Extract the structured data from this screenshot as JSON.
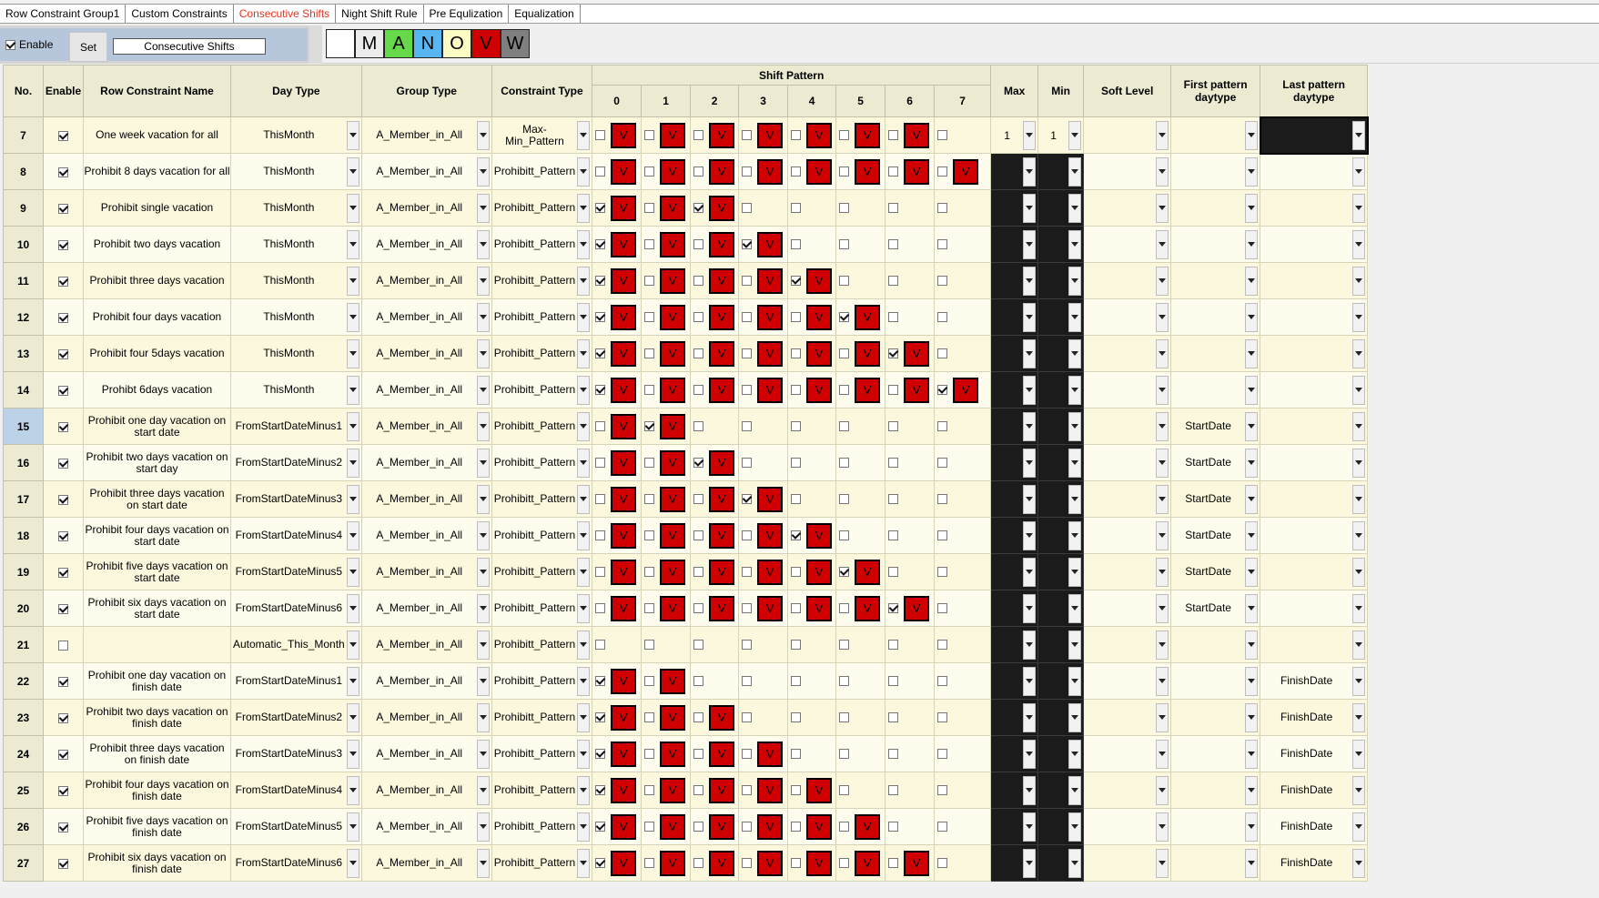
{
  "tabs": [
    "Row Constraint Group1",
    "Custom Constraints",
    "Consecutive Shifts",
    "Night Shift Rule",
    "Pre Equlization",
    "Equalization"
  ],
  "active_tab": 2,
  "toolbar": {
    "enable_label": "Enable",
    "set_label": "Set",
    "name_value": "Consecutive Shifts",
    "shift_buttons": [
      {
        "label": "",
        "color": "#ffffff"
      },
      {
        "label": "M",
        "color": "#ececec"
      },
      {
        "label": "A",
        "color": "#66d94a"
      },
      {
        "label": "N",
        "color": "#58b7f2"
      },
      {
        "label": "O",
        "color": "#fdfcc4"
      },
      {
        "label": "V",
        "color": "#d10000"
      },
      {
        "label": "W",
        "color": "#7f7f7f"
      }
    ]
  },
  "headers": {
    "no": "No.",
    "enable": "Enable",
    "name": "Row Constraint Name",
    "day_type": "Day Type",
    "group_type": "Group Type",
    "constraint_type": "Constraint Type",
    "shift_pattern": "Shift Pattern",
    "pattern_cols": [
      "0",
      "1",
      "2",
      "3",
      "4",
      "5",
      "6",
      "7"
    ],
    "max": "Max",
    "min": "Min",
    "soft_level": "Soft Level",
    "first_pattern": "First pattern daytype",
    "last_pattern": "Last pattern daytype"
  },
  "rows": [
    {
      "no": "7",
      "enable": true,
      "name": "One week vacation for all",
      "day_type": "ThisMonth",
      "group": "A_Member_in_All",
      "ctype": "Max-Min_Pattern",
      "pattern": [
        [
          false,
          true
        ],
        [
          false,
          true
        ],
        [
          false,
          true
        ],
        [
          false,
          true
        ],
        [
          false,
          true
        ],
        [
          false,
          true
        ],
        [
          false,
          true
        ],
        [
          false,
          false
        ]
      ],
      "max": "1",
      "min": "1",
      "first": "",
      "last": "",
      "selected": false
    },
    {
      "no": "8",
      "enable": true,
      "name": "Prohibit 8 days vacation for all",
      "day_type": "ThisMonth",
      "group": "A_Member_in_All",
      "ctype": "Prohibitt_Pattern",
      "pattern": [
        [
          false,
          true
        ],
        [
          false,
          true
        ],
        [
          false,
          true
        ],
        [
          false,
          true
        ],
        [
          false,
          true
        ],
        [
          false,
          true
        ],
        [
          false,
          true
        ],
        [
          false,
          true
        ]
      ],
      "max": "",
      "min": "",
      "first": "",
      "last": "",
      "selected": false
    },
    {
      "no": "9",
      "enable": true,
      "name": "Prohibit single vacation",
      "day_type": "ThisMonth",
      "group": "A_Member_in_All",
      "ctype": "Prohibitt_Pattern",
      "pattern": [
        [
          true,
          true
        ],
        [
          false,
          true
        ],
        [
          true,
          true
        ],
        [
          false,
          false
        ],
        [
          false,
          false
        ],
        [
          false,
          false
        ],
        [
          false,
          false
        ],
        [
          false,
          false
        ]
      ],
      "max": "",
      "min": "",
      "first": "",
      "last": "",
      "selected": false
    },
    {
      "no": "10",
      "enable": true,
      "name": "Prohibit two days vacation",
      "day_type": "ThisMonth",
      "group": "A_Member_in_All",
      "ctype": "Prohibitt_Pattern",
      "pattern": [
        [
          true,
          true
        ],
        [
          false,
          true
        ],
        [
          false,
          true
        ],
        [
          true,
          true
        ],
        [
          false,
          false
        ],
        [
          false,
          false
        ],
        [
          false,
          false
        ],
        [
          false,
          false
        ]
      ],
      "max": "",
      "min": "",
      "first": "",
      "last": "",
      "selected": false
    },
    {
      "no": "11",
      "enable": true,
      "name": "Prohibit three days vacation",
      "day_type": "ThisMonth",
      "group": "A_Member_in_All",
      "ctype": "Prohibitt_Pattern",
      "pattern": [
        [
          true,
          true
        ],
        [
          false,
          true
        ],
        [
          false,
          true
        ],
        [
          false,
          true
        ],
        [
          true,
          true
        ],
        [
          false,
          false
        ],
        [
          false,
          false
        ],
        [
          false,
          false
        ]
      ],
      "max": "",
      "min": "",
      "first": "",
      "last": "",
      "selected": false
    },
    {
      "no": "12",
      "enable": true,
      "name": "Prohibit four days vacation",
      "day_type": "ThisMonth",
      "group": "A_Member_in_All",
      "ctype": "Prohibitt_Pattern",
      "pattern": [
        [
          true,
          true
        ],
        [
          false,
          true
        ],
        [
          false,
          true
        ],
        [
          false,
          true
        ],
        [
          false,
          true
        ],
        [
          true,
          true
        ],
        [
          false,
          false
        ],
        [
          false,
          false
        ]
      ],
      "max": "",
      "min": "",
      "first": "",
      "last": "",
      "selected": false
    },
    {
      "no": "13",
      "enable": true,
      "name": "Prohibit four 5days vacation",
      "day_type": "ThisMonth",
      "group": "A_Member_in_All",
      "ctype": "Prohibitt_Pattern",
      "pattern": [
        [
          true,
          true
        ],
        [
          false,
          true
        ],
        [
          false,
          true
        ],
        [
          false,
          true
        ],
        [
          false,
          true
        ],
        [
          false,
          true
        ],
        [
          true,
          true
        ],
        [
          false,
          false
        ]
      ],
      "max": "",
      "min": "",
      "first": "",
      "last": "",
      "selected": false
    },
    {
      "no": "14",
      "enable": true,
      "name": "Prohibt 6days vacation",
      "day_type": "ThisMonth",
      "group": "A_Member_in_All",
      "ctype": "Prohibitt_Pattern",
      "pattern": [
        [
          true,
          true
        ],
        [
          false,
          true
        ],
        [
          false,
          true
        ],
        [
          false,
          true
        ],
        [
          false,
          true
        ],
        [
          false,
          true
        ],
        [
          false,
          true
        ],
        [
          true,
          true
        ]
      ],
      "max": "",
      "min": "",
      "first": "",
      "last": "",
      "selected": false
    },
    {
      "no": "15",
      "enable": true,
      "name": "Prohibit one day vacation on start date",
      "day_type": "FromStartDateMinus1",
      "group": "A_Member_in_All",
      "ctype": "Prohibitt_Pattern",
      "pattern": [
        [
          false,
          true
        ],
        [
          true,
          true
        ],
        [
          false,
          false
        ],
        [
          false,
          false
        ],
        [
          false,
          false
        ],
        [
          false,
          false
        ],
        [
          false,
          false
        ],
        [
          false,
          false
        ]
      ],
      "max": "",
      "min": "",
      "first": "StartDate",
      "last": "",
      "selected": true
    },
    {
      "no": "16",
      "enable": true,
      "name": "Prohibit two days vacation on start day",
      "day_type": "FromStartDateMinus2",
      "group": "A_Member_in_All",
      "ctype": "Prohibitt_Pattern",
      "pattern": [
        [
          false,
          true
        ],
        [
          false,
          true
        ],
        [
          true,
          true
        ],
        [
          false,
          false
        ],
        [
          false,
          false
        ],
        [
          false,
          false
        ],
        [
          false,
          false
        ],
        [
          false,
          false
        ]
      ],
      "max": "",
      "min": "",
      "first": "StartDate",
      "last": "",
      "selected": false
    },
    {
      "no": "17",
      "enable": true,
      "name": "Prohibit three days vacation on start date",
      "day_type": "FromStartDateMinus3",
      "group": "A_Member_in_All",
      "ctype": "Prohibitt_Pattern",
      "pattern": [
        [
          false,
          true
        ],
        [
          false,
          true
        ],
        [
          false,
          true
        ],
        [
          true,
          true
        ],
        [
          false,
          false
        ],
        [
          false,
          false
        ],
        [
          false,
          false
        ],
        [
          false,
          false
        ]
      ],
      "max": "",
      "min": "",
      "first": "StartDate",
      "last": "",
      "selected": false
    },
    {
      "no": "18",
      "enable": true,
      "name": "Prohibit four days vacation on start date",
      "day_type": "FromStartDateMinus4",
      "group": "A_Member_in_All",
      "ctype": "Prohibitt_Pattern",
      "pattern": [
        [
          false,
          true
        ],
        [
          false,
          true
        ],
        [
          false,
          true
        ],
        [
          false,
          true
        ],
        [
          true,
          true
        ],
        [
          false,
          false
        ],
        [
          false,
          false
        ],
        [
          false,
          false
        ]
      ],
      "max": "",
      "min": "",
      "first": "StartDate",
      "last": "",
      "selected": false
    },
    {
      "no": "19",
      "enable": true,
      "name": "Prohibit five days vacation on start date",
      "day_type": "FromStartDateMinus5",
      "group": "A_Member_in_All",
      "ctype": "Prohibitt_Pattern",
      "pattern": [
        [
          false,
          true
        ],
        [
          false,
          true
        ],
        [
          false,
          true
        ],
        [
          false,
          true
        ],
        [
          false,
          true
        ],
        [
          true,
          true
        ],
        [
          false,
          false
        ],
        [
          false,
          false
        ]
      ],
      "max": "",
      "min": "",
      "first": "StartDate",
      "last": "",
      "selected": false
    },
    {
      "no": "20",
      "enable": true,
      "name": "Prohibit six days vacation on start date",
      "day_type": "FromStartDateMinus6",
      "group": "A_Member_in_All",
      "ctype": "Prohibitt_Pattern",
      "pattern": [
        [
          false,
          true
        ],
        [
          false,
          true
        ],
        [
          false,
          true
        ],
        [
          false,
          true
        ],
        [
          false,
          true
        ],
        [
          false,
          true
        ],
        [
          true,
          true
        ],
        [
          false,
          false
        ]
      ],
      "max": "",
      "min": "",
      "first": "StartDate",
      "last": "",
      "selected": false
    },
    {
      "no": "21",
      "enable": false,
      "name": "",
      "day_type": "Automatic_This_Month",
      "group": "A_Member_in_All",
      "ctype": "Prohibitt_Pattern",
      "pattern": [
        [
          false,
          false
        ],
        [
          false,
          false
        ],
        [
          false,
          false
        ],
        [
          false,
          false
        ],
        [
          false,
          false
        ],
        [
          false,
          false
        ],
        [
          false,
          false
        ],
        [
          false,
          false
        ]
      ],
      "max": "",
      "min": "",
      "first": "",
      "last": "",
      "selected": false
    },
    {
      "no": "22",
      "enable": true,
      "name": "Prohibit one day vacation on finish date",
      "day_type": "FromStartDateMinus1",
      "group": "A_Member_in_All",
      "ctype": "Prohibitt_Pattern",
      "pattern": [
        [
          true,
          true
        ],
        [
          false,
          true
        ],
        [
          false,
          false
        ],
        [
          false,
          false
        ],
        [
          false,
          false
        ],
        [
          false,
          false
        ],
        [
          false,
          false
        ],
        [
          false,
          false
        ]
      ],
      "max": "",
      "min": "",
      "first": "",
      "last": "FinishDate",
      "selected": false
    },
    {
      "no": "23",
      "enable": true,
      "name": "Prohibit two days vacation on finish date",
      "day_type": "FromStartDateMinus2",
      "group": "A_Member_in_All",
      "ctype": "Prohibitt_Pattern",
      "pattern": [
        [
          true,
          true
        ],
        [
          false,
          true
        ],
        [
          false,
          true
        ],
        [
          false,
          false
        ],
        [
          false,
          false
        ],
        [
          false,
          false
        ],
        [
          false,
          false
        ],
        [
          false,
          false
        ]
      ],
      "max": "",
      "min": "",
      "first": "",
      "last": "FinishDate",
      "selected": false
    },
    {
      "no": "24",
      "enable": true,
      "name": "Prohibit three days vacation on finish date",
      "day_type": "FromStartDateMinus3",
      "group": "A_Member_in_All",
      "ctype": "Prohibitt_Pattern",
      "pattern": [
        [
          true,
          true
        ],
        [
          false,
          true
        ],
        [
          false,
          true
        ],
        [
          false,
          true
        ],
        [
          false,
          false
        ],
        [
          false,
          false
        ],
        [
          false,
          false
        ],
        [
          false,
          false
        ]
      ],
      "max": "",
      "min": "",
      "first": "",
      "last": "FinishDate",
      "selected": false
    },
    {
      "no": "25",
      "enable": true,
      "name": "Prohibit four days vacation on finish date",
      "day_type": "FromStartDateMinus4",
      "group": "A_Member_in_All",
      "ctype": "Prohibitt_Pattern",
      "pattern": [
        [
          true,
          true
        ],
        [
          false,
          true
        ],
        [
          false,
          true
        ],
        [
          false,
          true
        ],
        [
          false,
          true
        ],
        [
          false,
          false
        ],
        [
          false,
          false
        ],
        [
          false,
          false
        ]
      ],
      "max": "",
      "min": "",
      "first": "",
      "last": "FinishDate",
      "selected": false
    },
    {
      "no": "26",
      "enable": true,
      "name": "Prohibit five days vacation on finish date",
      "day_type": "FromStartDateMinus5",
      "group": "A_Member_in_All",
      "ctype": "Prohibitt_Pattern",
      "pattern": [
        [
          true,
          true
        ],
        [
          false,
          true
        ],
        [
          false,
          true
        ],
        [
          false,
          true
        ],
        [
          false,
          true
        ],
        [
          false,
          true
        ],
        [
          false,
          false
        ],
        [
          false,
          false
        ]
      ],
      "max": "",
      "min": "",
      "first": "",
      "last": "FinishDate",
      "selected": false
    },
    {
      "no": "27",
      "enable": true,
      "name": "Prohibit six days vacation on finish date",
      "day_type": "FromStartDateMinus6",
      "group": "A_Member_in_All",
      "ctype": "Prohibitt_Pattern",
      "pattern": [
        [
          true,
          true
        ],
        [
          false,
          true
        ],
        [
          false,
          true
        ],
        [
          false,
          true
        ],
        [
          false,
          true
        ],
        [
          false,
          true
        ],
        [
          false,
          true
        ],
        [
          false,
          false
        ]
      ],
      "max": "",
      "min": "",
      "first": "",
      "last": "FinishDate",
      "selected": false
    }
  ],
  "v_label": "V"
}
